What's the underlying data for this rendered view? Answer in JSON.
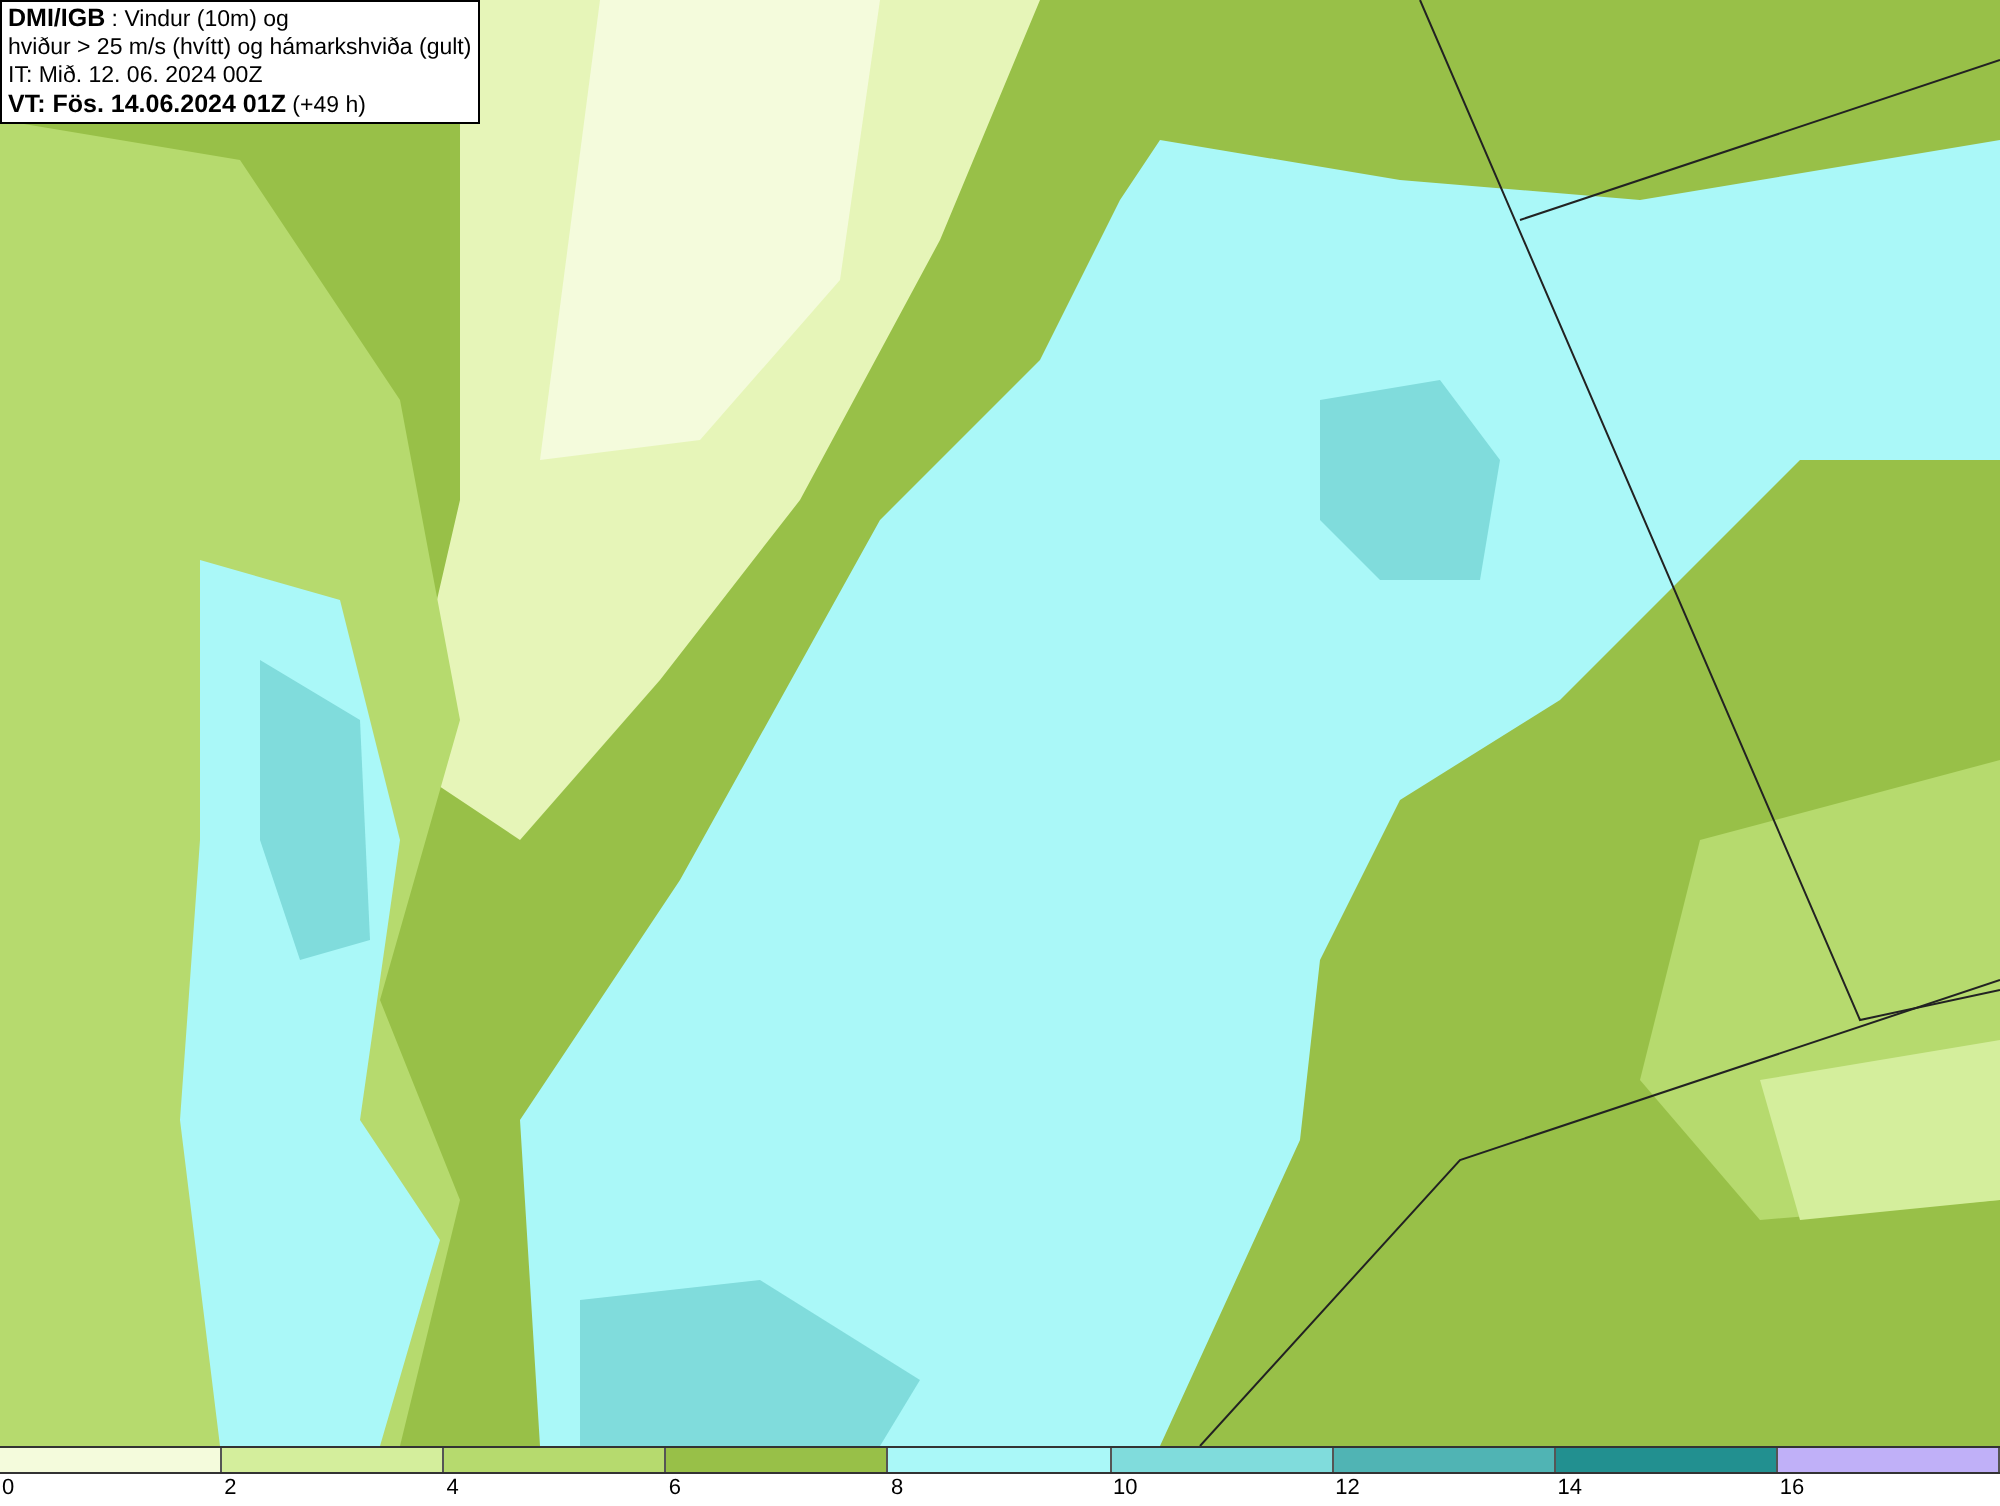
{
  "header": {
    "lines": [
      "**DMI/IGB** : Vindur (10m) og",
      "hviður > 25 m/s (hvítt) og hámarkshviða (gult)",
      "IT: Mið. 12. 06. 2024 00Z",
      "**VT: Fös. 14.06.2024 01Z** (+49 h)"
    ]
  },
  "legend": {
    "bins": [
      {
        "label": "0",
        "color": "#f4fbdc"
      },
      {
        "label": "2",
        "color": "#d4ee9c"
      },
      {
        "label": "4",
        "color": "#b6da6e"
      },
      {
        "label": "6",
        "color": "#98c048"
      },
      {
        "label": "8",
        "color": "#aaf8f8"
      },
      {
        "label": "10",
        "color": "#80dcdc"
      },
      {
        "label": "12",
        "color": "#50b4b4"
      },
      {
        "label": "14",
        "color": "#229090"
      },
      {
        "label": "16",
        "color": "#c0b0f8"
      }
    ]
  }
}
